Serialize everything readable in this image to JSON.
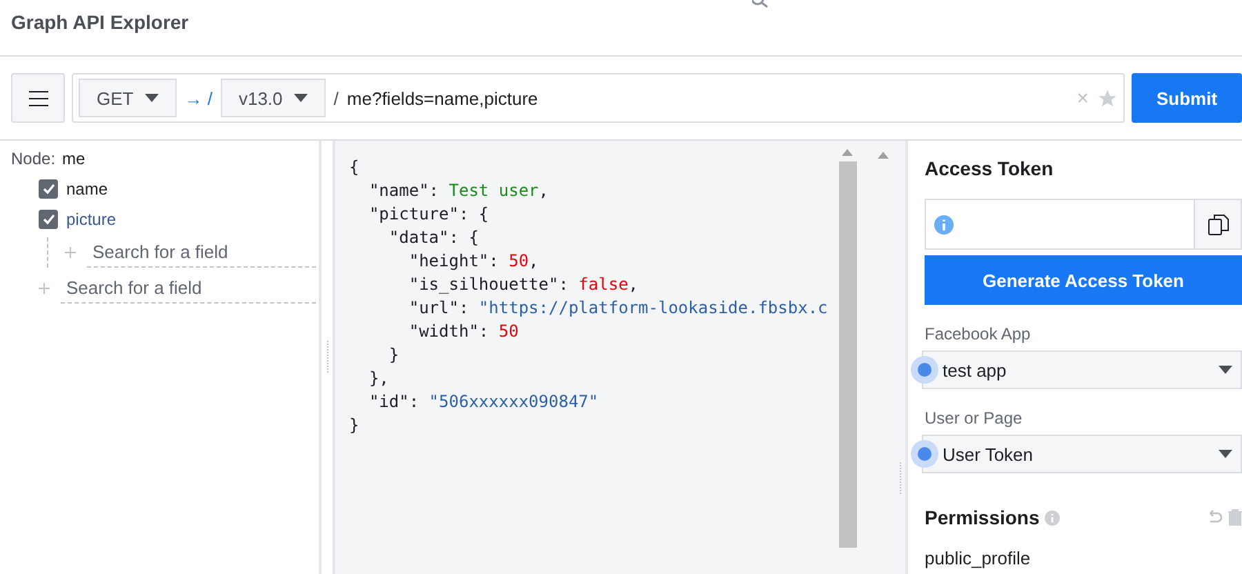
{
  "header": {
    "title": "Graph API Explorer"
  },
  "request": {
    "method": "GET",
    "arrow": "→ /",
    "version": "v13.0",
    "separator": "/",
    "path": "me?fields=name,picture",
    "clear": "×",
    "submit": "Submit"
  },
  "fields": {
    "node_label": "Node:",
    "node": "me",
    "items": [
      {
        "label": "name",
        "checked": true,
        "expanded": false
      },
      {
        "label": "picture",
        "checked": true,
        "expanded": true,
        "search_placeholder": "Search for a field"
      }
    ],
    "search_placeholder": "Search for a field"
  },
  "response": {
    "lines": [
      [
        {
          "kind": "plain",
          "text": "{"
        }
      ],
      [
        {
          "kind": "plain",
          "text": "  \"name\": "
        },
        {
          "kind": "name",
          "text": "Test user"
        },
        {
          "kind": "plain",
          "text": ","
        }
      ],
      [
        {
          "kind": "plain",
          "text": "  \"picture\": {"
        }
      ],
      [
        {
          "kind": "plain",
          "text": "    \"data\": {"
        }
      ],
      [
        {
          "kind": "plain",
          "text": "      \"height\": "
        },
        {
          "kind": "number",
          "text": "50"
        },
        {
          "kind": "plain",
          "text": ","
        }
      ],
      [
        {
          "kind": "plain",
          "text": "      \"is_silhouette\": "
        },
        {
          "kind": "number",
          "text": "false"
        },
        {
          "kind": "plain",
          "text": ","
        }
      ],
      [
        {
          "kind": "plain",
          "text": "      \"url\": "
        },
        {
          "kind": "string",
          "text": "\"https://platform-lookaside.fbsbx.c"
        }
      ],
      [
        {
          "kind": "plain",
          "text": "      \"width\": "
        },
        {
          "kind": "number",
          "text": "50"
        }
      ],
      [
        {
          "kind": "plain",
          "text": "    }"
        }
      ],
      [
        {
          "kind": "plain",
          "text": "  },"
        }
      ],
      [
        {
          "kind": "plain",
          "text": "  \"id\": "
        },
        {
          "kind": "string",
          "text": "\"506xxxxxx090847\""
        }
      ],
      [
        {
          "kind": "plain",
          "text": "}"
        }
      ]
    ]
  },
  "access": {
    "title": "Access Token",
    "generate": "Generate Access Token",
    "selects": [
      {
        "label": "Facebook App",
        "value": "test app"
      },
      {
        "label": "User or Page",
        "value": "User Token"
      }
    ],
    "permissions_title": "Permissions",
    "permissions": [
      "public_profile"
    ]
  }
}
